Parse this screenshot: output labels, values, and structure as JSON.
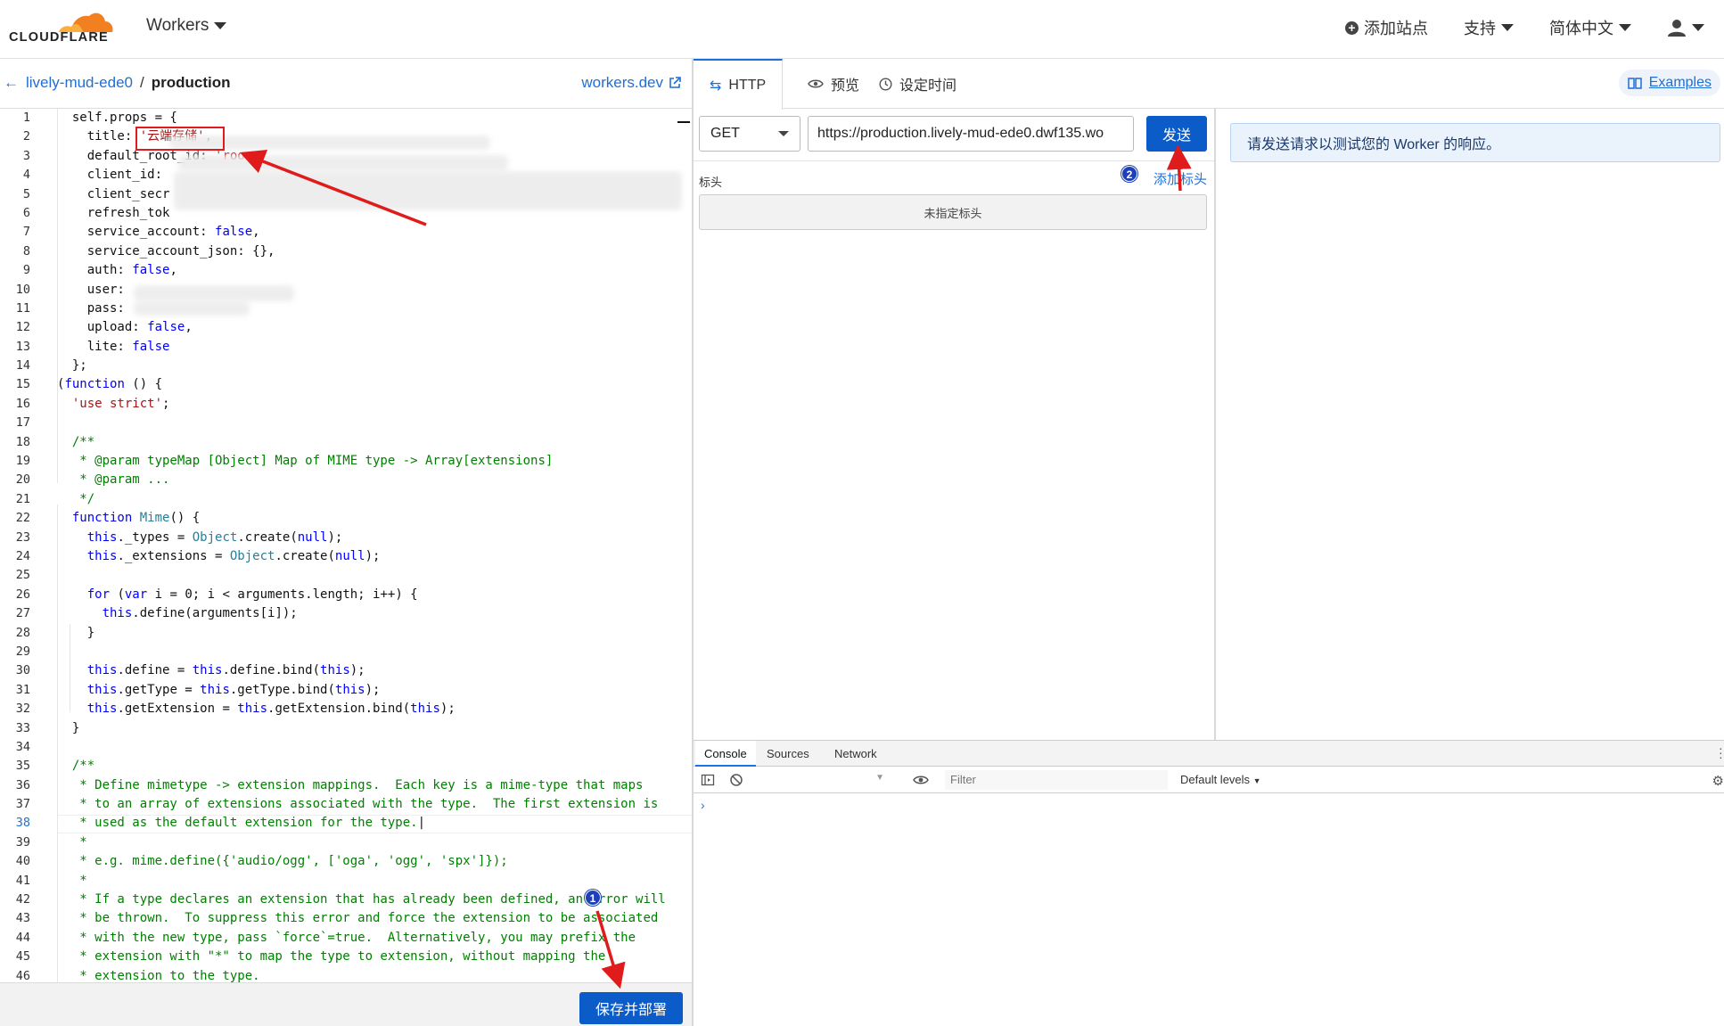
{
  "topnav": {
    "logo_text": "CLOUDFLARE",
    "product": "Workers",
    "add_site": "添加站点",
    "support": "支持",
    "language": "简体中文"
  },
  "editor_header": {
    "back_project": "lively-mud-ede0",
    "separator": "/",
    "environment": "production",
    "workers_dev": "workers.dev"
  },
  "editor": {
    "line_numbers": [
      "1",
      "2",
      "3",
      "4",
      "5",
      "6",
      "7",
      "8",
      "9",
      "10",
      "11",
      "12",
      "13",
      "14",
      "15",
      "16",
      "17",
      "18",
      "19",
      "20",
      "21",
      "22",
      "23",
      "24",
      "25",
      "26",
      "27",
      "28",
      "29",
      "30",
      "31",
      "32",
      "33",
      "34",
      "35",
      "36",
      "37",
      "38",
      "39",
      "40",
      "41",
      "42",
      "43",
      "44",
      "45",
      "46"
    ],
    "current_line": "38",
    "save_button": "保存并部署"
  },
  "tabs": {
    "http": "HTTP",
    "preview": "预览",
    "schedule": "设定时间",
    "examples": "Examples"
  },
  "request": {
    "method": "GET",
    "url": "https://production.lively-mud-ede0.dwf135.wo",
    "send": "发送",
    "headers_label": "标头",
    "add_header": "添加标头",
    "no_headers": "未指定标头"
  },
  "response": {
    "message": "请发送请求以测试您的 Worker 的响应。"
  },
  "devtools": {
    "tabs": [
      "Console",
      "Sources",
      "Network"
    ],
    "filter_placeholder": "Filter",
    "levels": "Default levels",
    "prompt": "›"
  },
  "annotations": {
    "badge_1": "1",
    "badge_2": "2"
  },
  "colors": {
    "accent": "#0b5cc9",
    "link": "#1f6fd6",
    "annotation": "#e01b1b",
    "logo_orange": "#f38020"
  }
}
